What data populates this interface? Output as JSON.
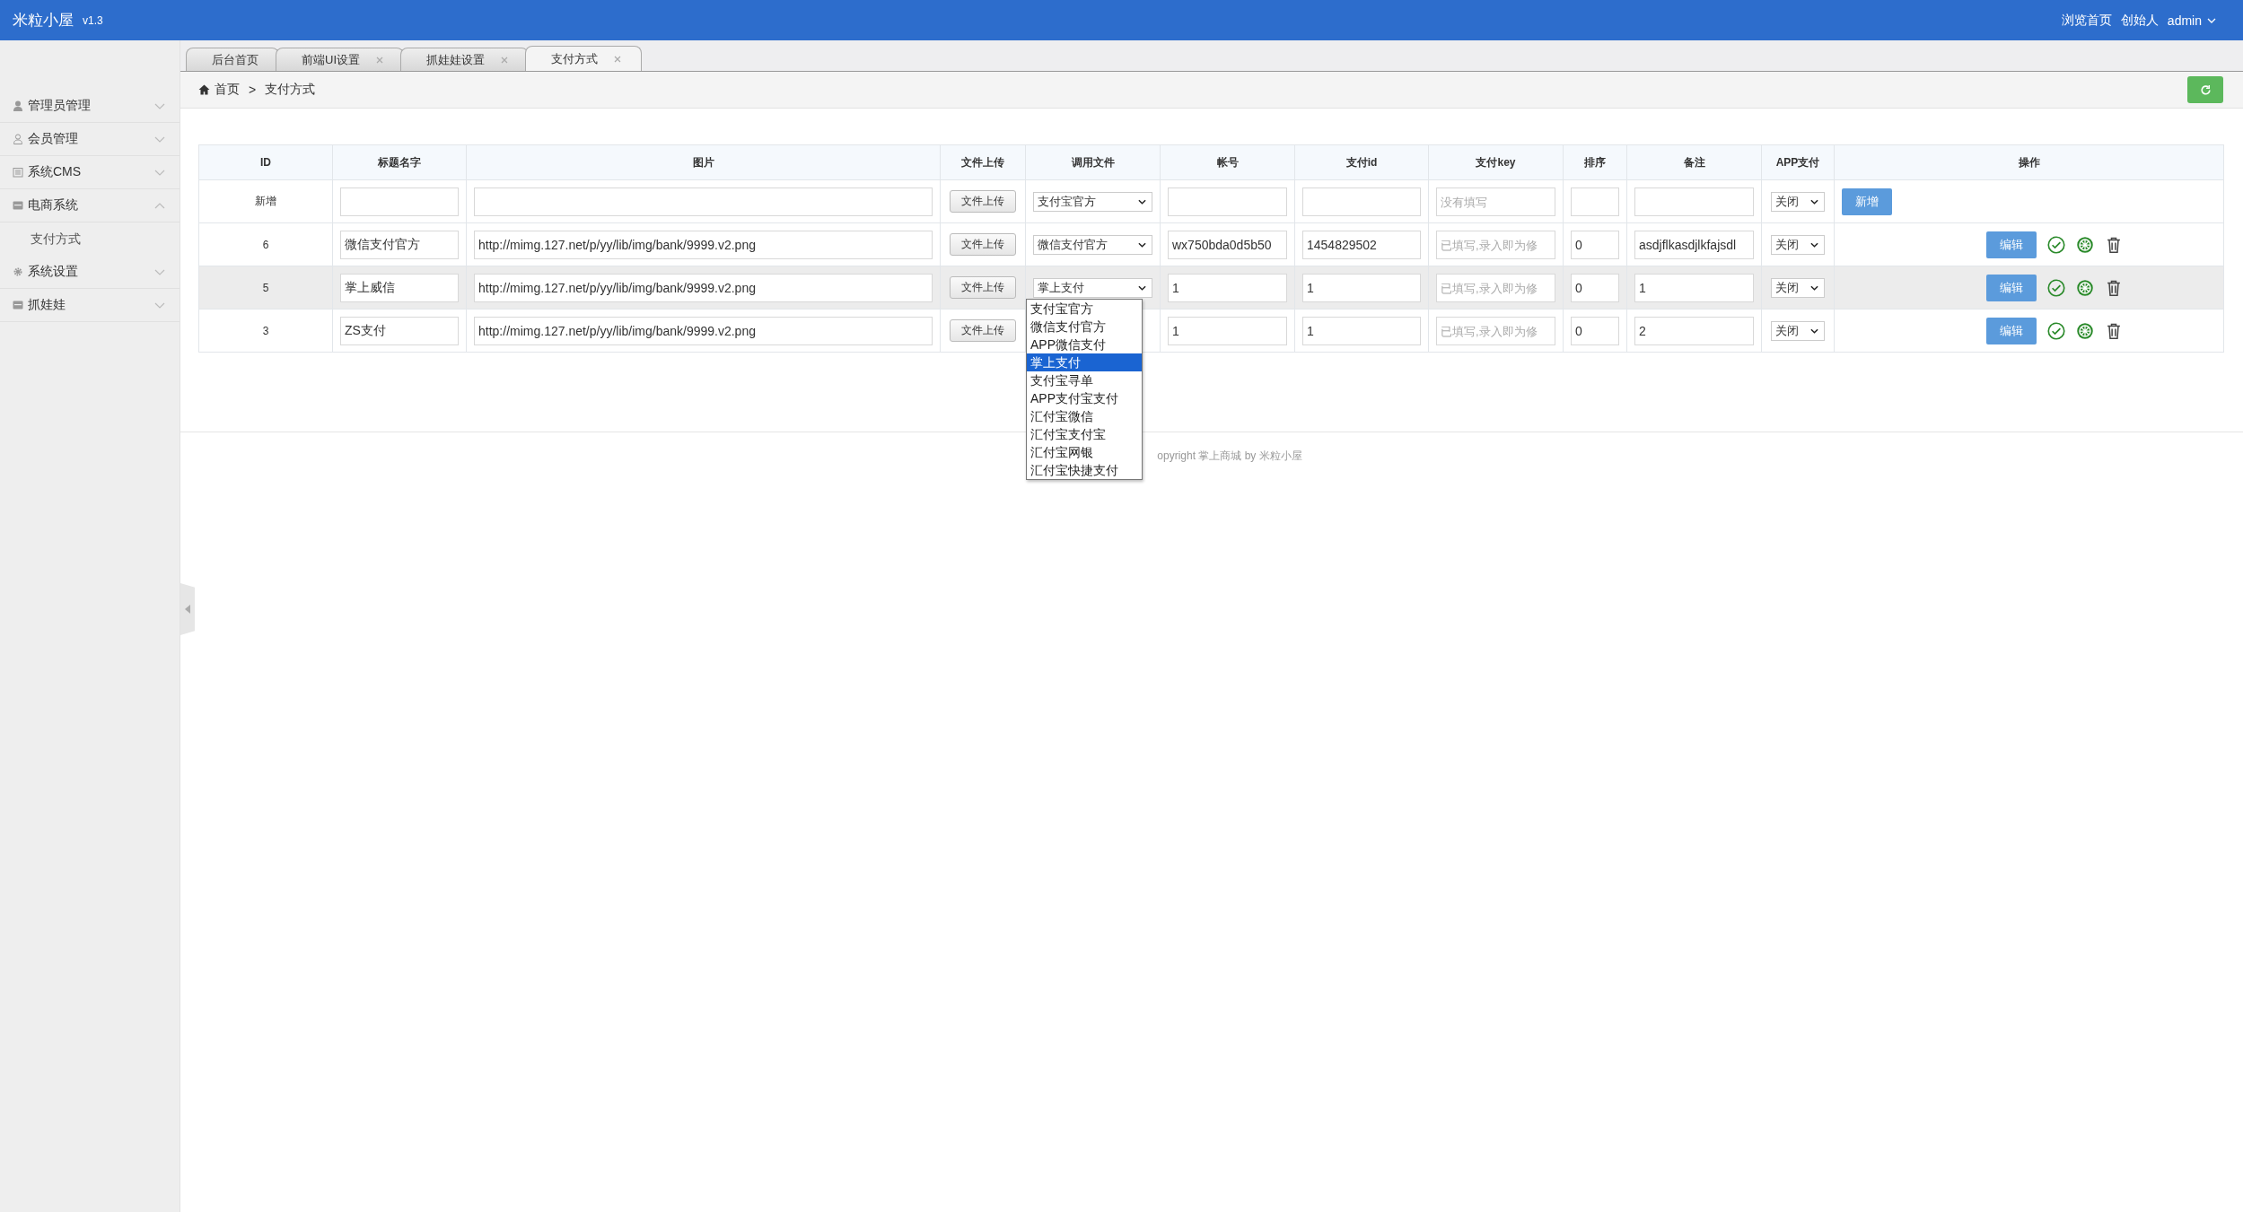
{
  "header": {
    "logo": "米粒小屋",
    "version": "v1.3",
    "links": [
      "浏览首页",
      "创始人"
    ],
    "user": "admin"
  },
  "sidebar": {
    "items": [
      {
        "label": "管理员管理",
        "expanded": false
      },
      {
        "label": "会员管理",
        "expanded": false
      },
      {
        "label": "系统CMS",
        "expanded": false
      },
      {
        "label": "电商系统",
        "expanded": true,
        "children": [
          {
            "label": "支付方式"
          }
        ]
      },
      {
        "label": "系统设置",
        "expanded": false
      },
      {
        "label": "抓娃娃",
        "expanded": false
      }
    ]
  },
  "tabs": [
    {
      "label": "后台首页",
      "closable": false,
      "selected": false
    },
    {
      "label": "前端UI设置",
      "closable": true,
      "selected": false
    },
    {
      "label": "抓娃娃设置",
      "closable": true,
      "selected": false
    },
    {
      "label": "支付方式",
      "closable": true,
      "selected": true
    }
  ],
  "breadcrumb": [
    "首页",
    ">",
    "支付方式"
  ],
  "table": {
    "columns": [
      "ID",
      "标题名字",
      "图片",
      "文件上传",
      "调用文件",
      "帐号",
      "支付id",
      "支付key",
      "排序",
      "备注",
      "APP支付",
      "操作"
    ],
    "rows": [
      {
        "kind": "new",
        "id": "新增",
        "upload": "文件上传",
        "file": "支付宝官方",
        "key_placeholder": "没有填写",
        "app_pay": "关闭",
        "action": "新增",
        "selected": false
      },
      {
        "kind": "item",
        "id": "6",
        "title": "微信支付官方",
        "image": "http://mimg.127.net/p/yy/lib/img/bank/9999.v2.png",
        "upload": "文件上传",
        "file": "微信支付官方",
        "account": "wx750bda0d5b50",
        "pay_id": "1454829502",
        "key_placeholder": "已填写,录入即为修",
        "sort": "0",
        "note": "asdjflkasdjlkfajsdl",
        "app_pay": "关闭",
        "action": "编辑",
        "selected": false
      },
      {
        "kind": "item",
        "id": "5",
        "title": "掌上威信",
        "image": "http://mimg.127.net/p/yy/lib/img/bank/9999.v2.png",
        "upload": "文件上传",
        "file": "掌上支付",
        "account": "1",
        "pay_id": "1",
        "key_placeholder": "已填写,录入即为修",
        "sort": "0",
        "note": "1",
        "app_pay": "关闭",
        "action": "编辑",
        "selected": true,
        "dropdown": [
          {
            "label": "支付宝官方",
            "selected": false
          },
          {
            "label": "微信支付官方",
            "selected": false
          },
          {
            "label": "APP微信支付",
            "selected": false
          },
          {
            "label": "掌上支付",
            "selected": true
          },
          {
            "label": "支付宝寻单",
            "selected": false
          },
          {
            "label": "APP支付宝支付",
            "selected": false
          },
          {
            "label": "汇付宝微信",
            "selected": false
          },
          {
            "label": "汇付宝支付宝",
            "selected": false
          },
          {
            "label": "汇付宝网银",
            "selected": false
          },
          {
            "label": "汇付宝快捷支付",
            "selected": false
          }
        ]
      },
      {
        "kind": "item",
        "id": "3",
        "title": "ZS支付",
        "image": "http://mimg.127.net/p/yy/lib/img/bank/9999.v2.png",
        "upload": "文件上传",
        "account": "1",
        "pay_id": "1",
        "key_placeholder": "已填写,录入即为修",
        "sort": "0",
        "note": "2",
        "app_pay": "关闭",
        "action": "编辑",
        "selected": false
      }
    ]
  },
  "footer": "opyright 掌上商城 by 米粒小屋"
}
